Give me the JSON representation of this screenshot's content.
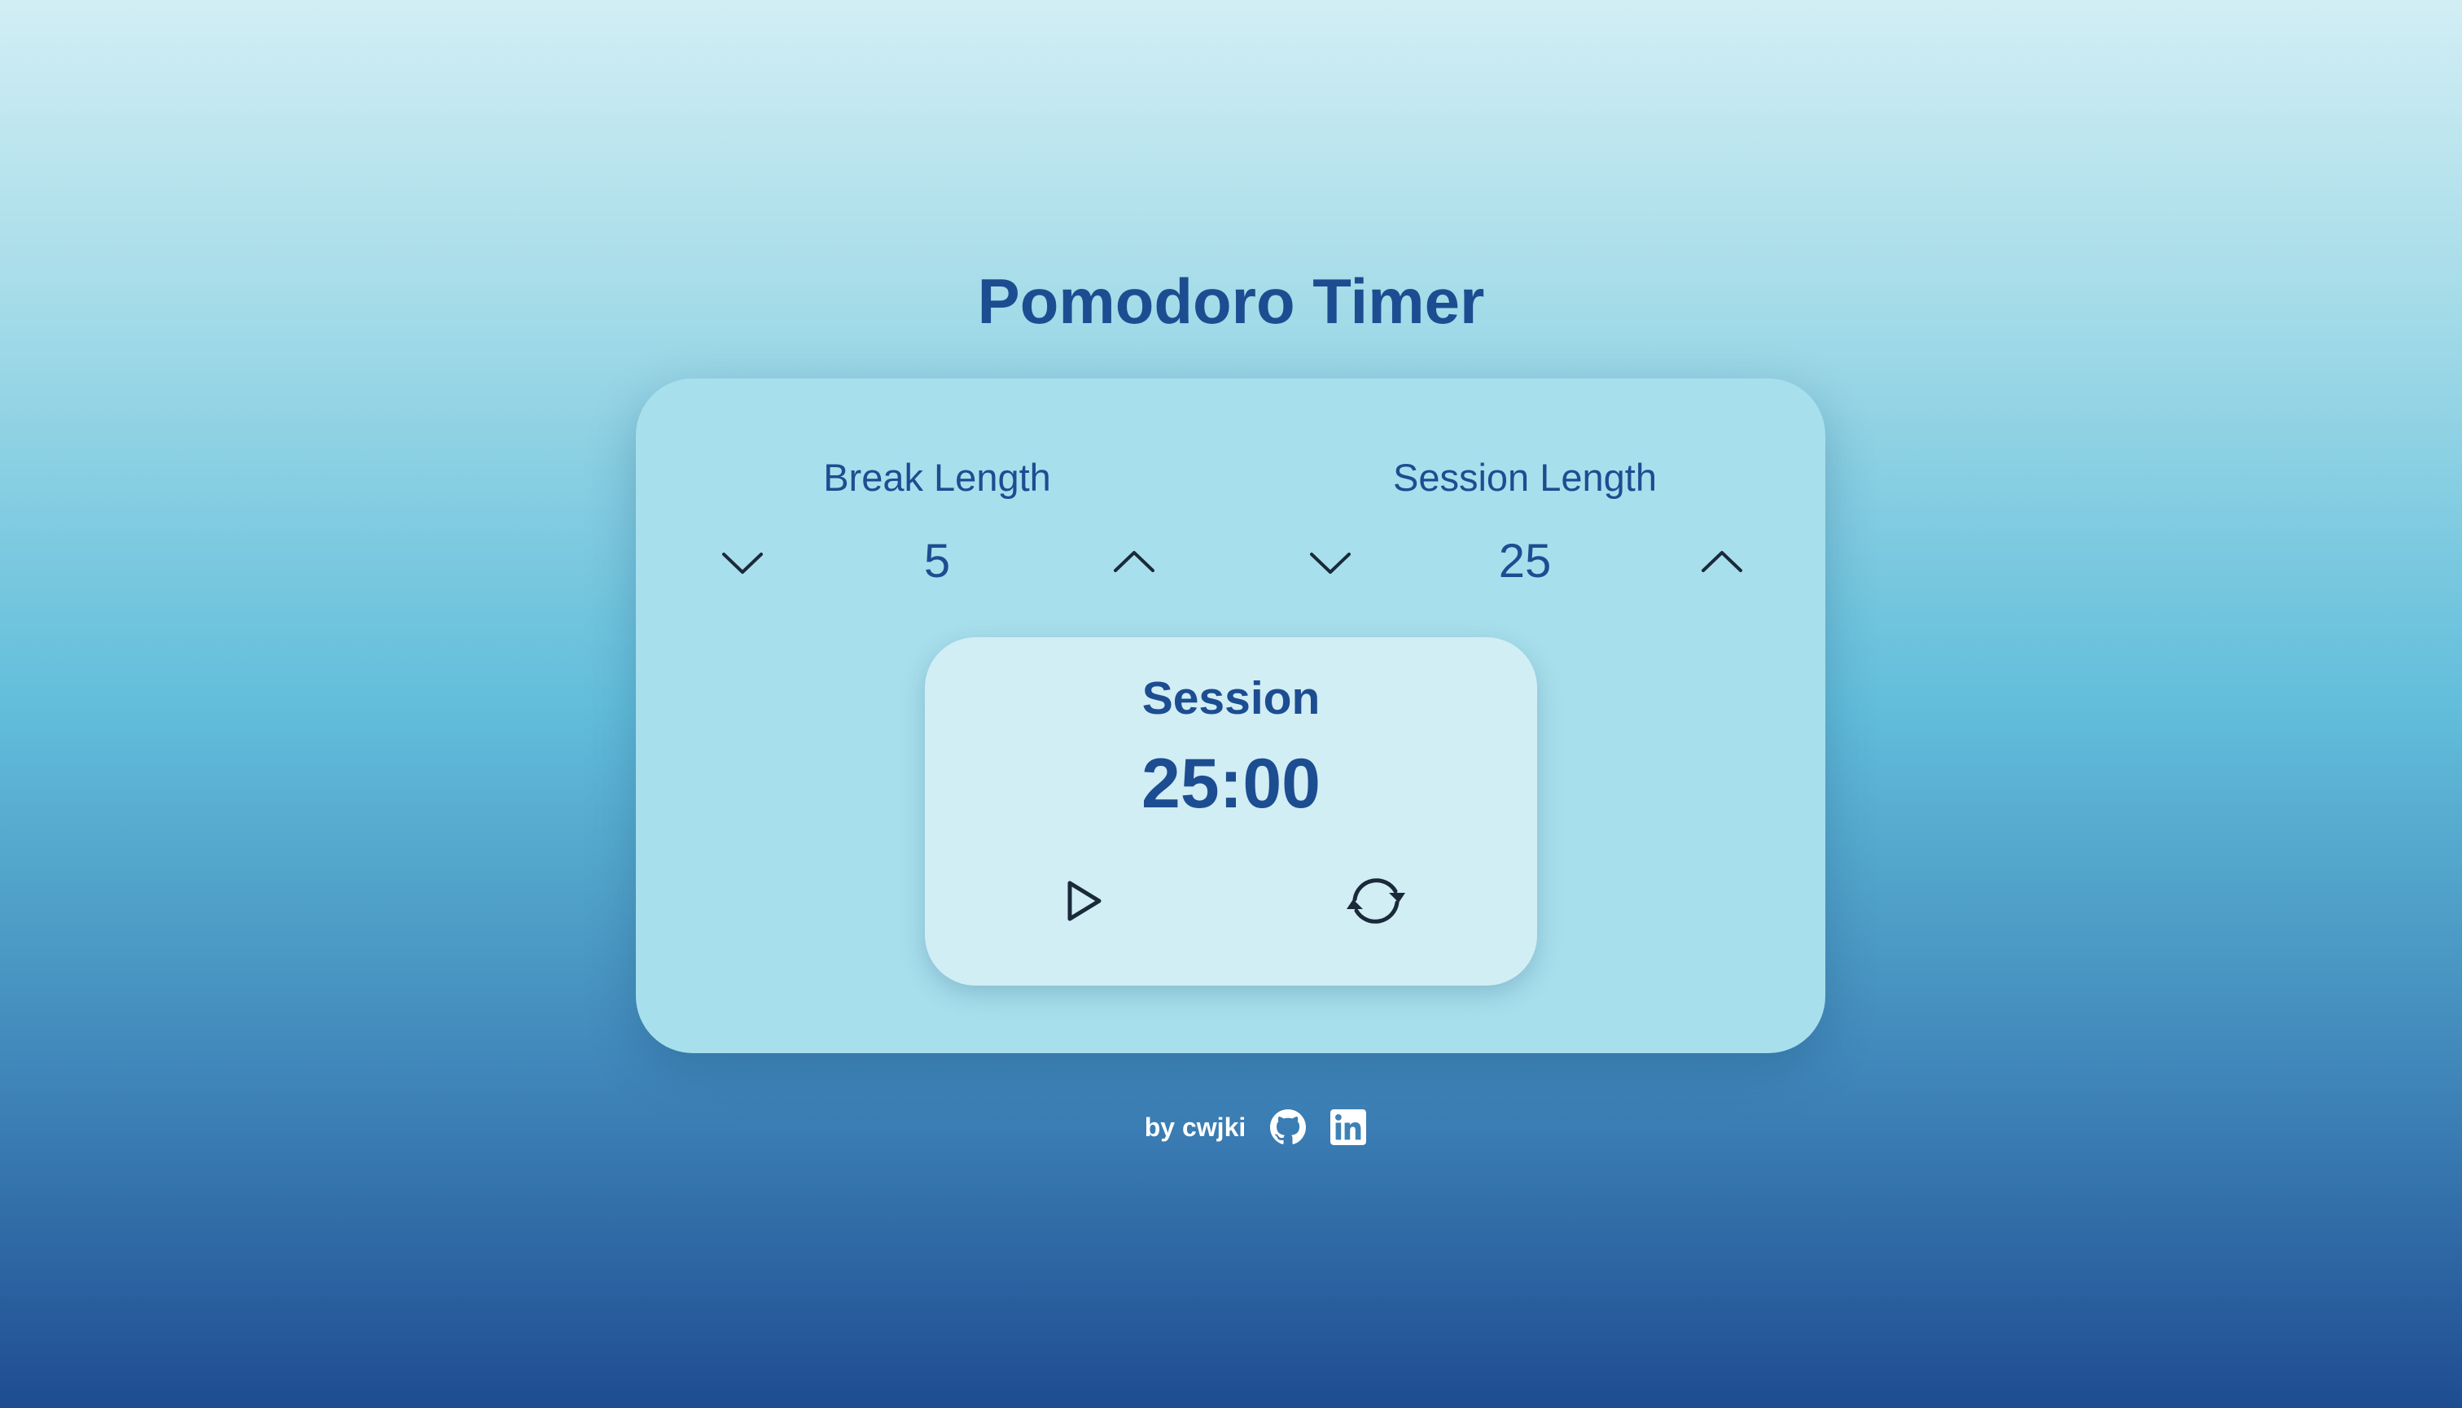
{
  "app": {
    "title": "Pomodoro Timer"
  },
  "break": {
    "label": "Break Length",
    "value": "5",
    "decrement_icon": "chevron-down-icon",
    "increment_icon": "chevron-up-icon"
  },
  "session": {
    "label": "Session Length",
    "value": "25",
    "decrement_icon": "chevron-down-icon",
    "increment_icon": "chevron-up-icon"
  },
  "timer": {
    "label": "Session",
    "time": "25:00",
    "play_icon": "play-icon",
    "reset_icon": "refresh-icon"
  },
  "footer": {
    "author_text": "by cwjki",
    "github_icon": "github-icon",
    "linkedin_icon": "linkedin-icon"
  },
  "colors": {
    "primary_text": "#1d4d91",
    "card_bg": "#a8dfec",
    "timer_bg": "#d1eef5",
    "footer_text": "#ffffff",
    "icon_stroke": "#1a2a3a"
  }
}
